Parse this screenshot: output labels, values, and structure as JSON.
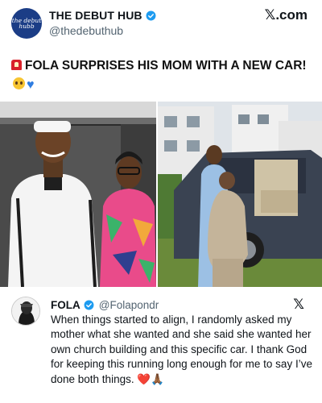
{
  "header": {
    "avatar_text": "the debut hubb",
    "account_name": "THE DEBUT HUB",
    "handle": "@thedebuthub",
    "brand": "𝕏.com",
    "verified_color": "#1d9bf0"
  },
  "headline": {
    "text": "FOLA SURPRISES HIS MOM WITH A NEW CAR!",
    "icons": [
      "siren-icon",
      "pleading-face-emoji",
      "blue-heart-emoji"
    ]
  },
  "photos": {
    "left": "photo-fola-and-mother",
    "right": "photo-mother-with-new-car"
  },
  "tweet": {
    "name": "FOLA",
    "handle": "@Folapondr",
    "brand": "𝕏",
    "text": "When things started to align, I randomly asked my mother what she wanted and she said she wanted her own church building and this specific car. I thank God for keeping this running long enough for me to say I’ve done both things.",
    "end_emojis": "❤️🙏🏾"
  }
}
